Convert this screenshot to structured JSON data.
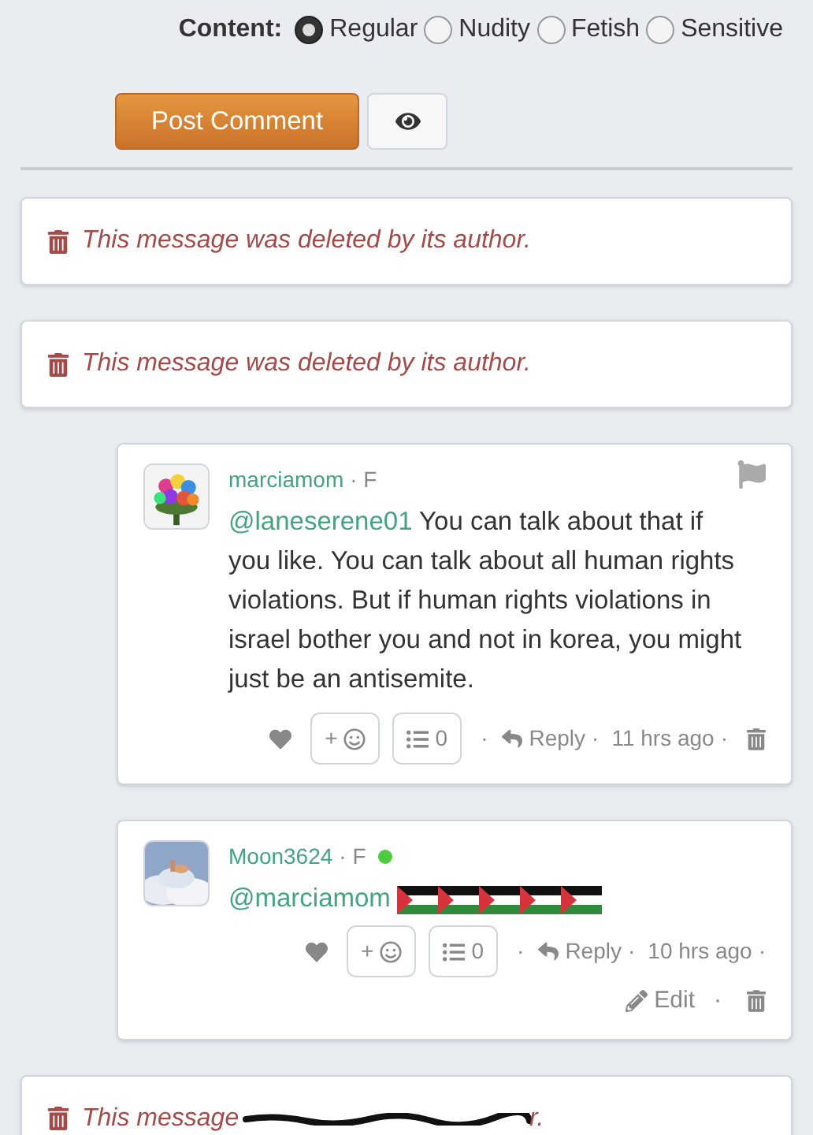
{
  "content_filter": {
    "label": "Content:",
    "options": [
      {
        "label": "Regular",
        "selected": true
      },
      {
        "label": "Nudity",
        "selected": false
      },
      {
        "label": "Fetish",
        "selected": false
      },
      {
        "label": "Sensitive",
        "selected": false
      }
    ]
  },
  "post_button": "Post Comment",
  "comments": [
    {
      "kind": "deleted",
      "parts": [
        {
          "text": "This message was deleted by its author.",
          "scribbled": false
        }
      ]
    },
    {
      "kind": "deleted",
      "parts": [
        {
          "text": "This message was deleted by its author.",
          "scribbled": false
        }
      ]
    },
    {
      "kind": "comment",
      "username": "marciamom",
      "meta": "· F",
      "online": false,
      "flag_button": true,
      "mention": "@laneserene01",
      "body": " You can talk about that if you like. You can talk about all human rights violations. But if human rights violations in israel bother you and not in korea, you might just be an antisemite.",
      "reaction_button": "+",
      "list_count": "0",
      "reply": "Reply",
      "time": "11 hrs ago",
      "dots": [
        "·",
        "·",
        "·"
      ],
      "avatar": {
        "kind": "picture"
      }
    },
    {
      "kind": "comment",
      "username": "Moon3624",
      "meta": "· F",
      "online": true,
      "flag_button": false,
      "mention": "@marciamom",
      "emoji": [
        {
          "kind": "flag"
        },
        {
          "kind": "flag"
        },
        {
          "kind": "flag"
        },
        {
          "kind": "flag"
        },
        {
          "kind": "flag"
        }
      ],
      "reaction_button": "+",
      "list_count": "0",
      "reply": "Reply",
      "time": "10 hrs ago",
      "dots": [
        "·",
        "·",
        "·"
      ],
      "edit": "Edit",
      "edit_dot": "·",
      "avatar": {
        "kind": "picture"
      }
    },
    {
      "kind": "deleted",
      "parts": [
        {
          "text": "This message ",
          "scribbled": false
        },
        {
          "kind": "scribble",
          "scribbled": true
        },
        {
          "text": "r.",
          "scribbled": false
        }
      ]
    }
  ]
}
